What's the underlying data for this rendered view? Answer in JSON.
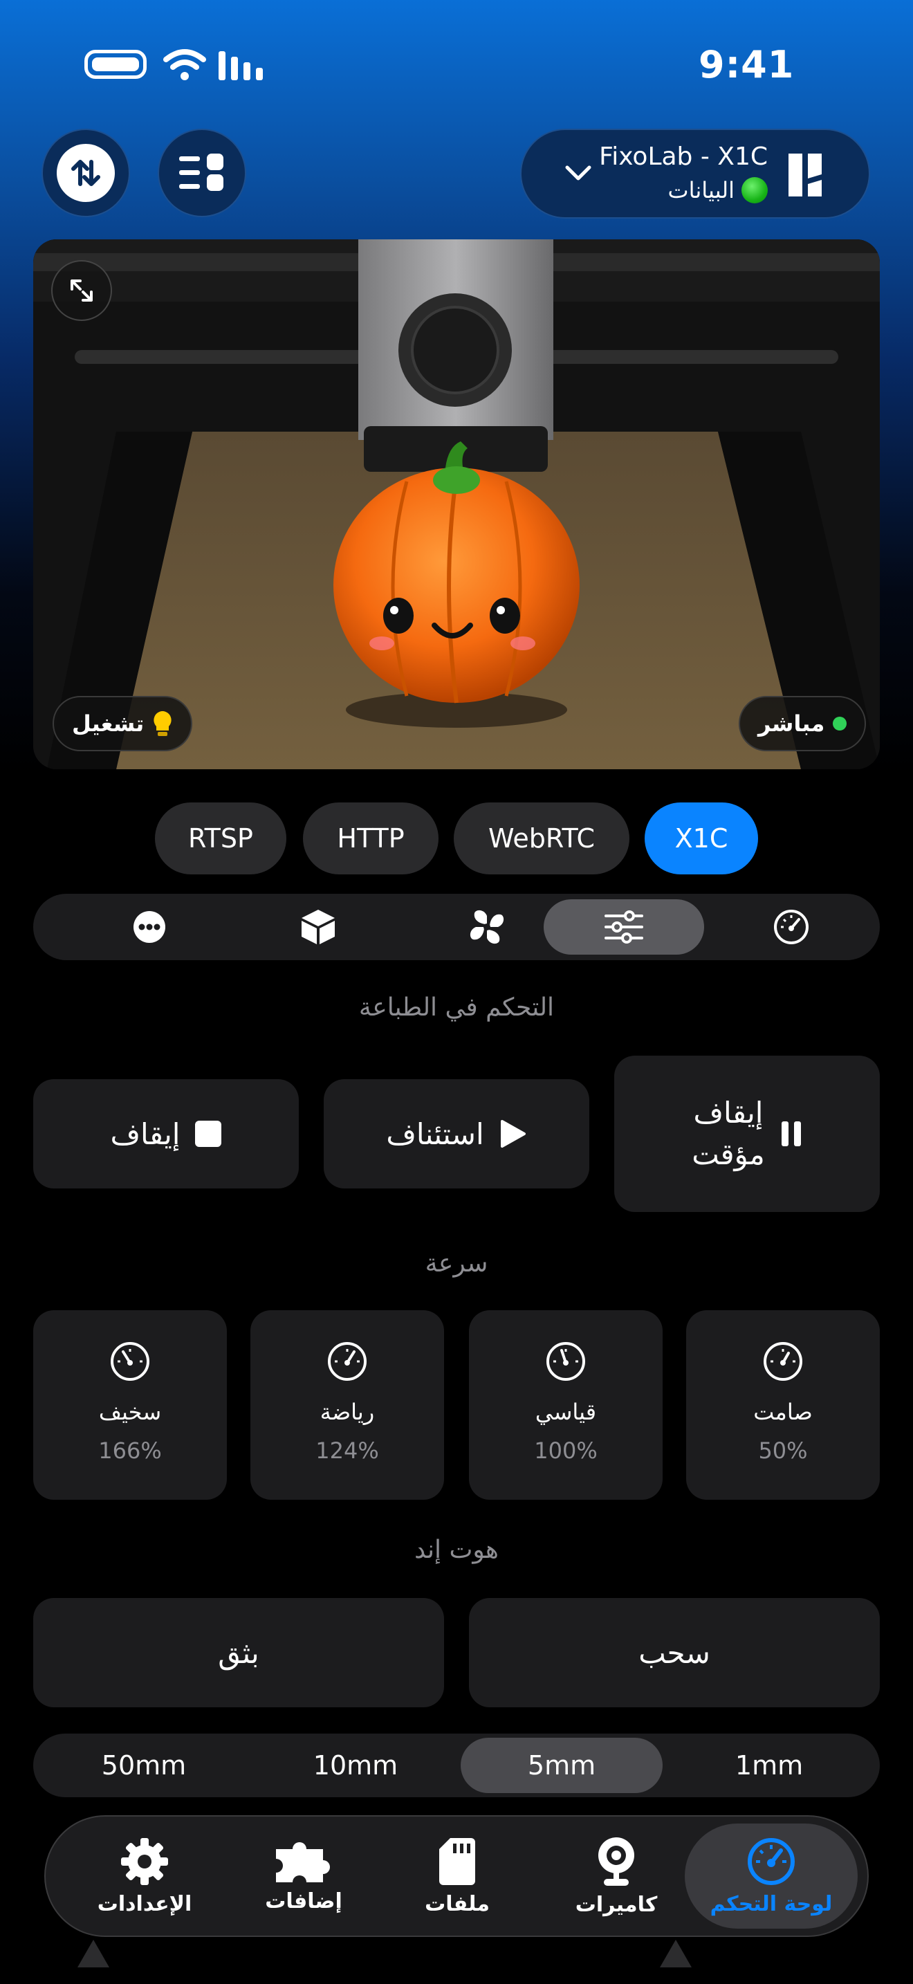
{
  "status_bar": {
    "time": "9:41"
  },
  "header": {
    "printer_name": "FixoLab - X1C",
    "printer_status": "البيانات",
    "status_color": "#1db41d"
  },
  "camera": {
    "live_label": "مباشر",
    "light_label": "تشغيل",
    "live_dot_color": "#30d158"
  },
  "stream_tabs": [
    {
      "label": "RTSP",
      "active": false
    },
    {
      "label": "HTTP",
      "active": false
    },
    {
      "label": "WebRTC",
      "active": false
    },
    {
      "label": "X1C",
      "active": true
    }
  ],
  "segment_icons": [
    "more-icon",
    "box-icon",
    "fan-icon",
    "sliders-icon",
    "gauge-icon"
  ],
  "segment_active": "sliders-icon",
  "printer_control": {
    "title": "التحكم في الطباعة",
    "stop_label": "إيقاف",
    "resume_label": "استئناف",
    "pause_label_line1": "إيقاف",
    "pause_label_line2": "مؤقت"
  },
  "speed": {
    "title": "سرعة",
    "modes": [
      {
        "name": "سخيف",
        "value": "166%"
      },
      {
        "name": "رياضة",
        "value": "124%"
      },
      {
        "name": "قياسي",
        "value": "100%"
      },
      {
        "name": "صامت",
        "value": "50%"
      }
    ]
  },
  "hotend": {
    "title": "هوت إند",
    "extrude_label": "بثق",
    "retract_label": "سحب"
  },
  "distances": [
    {
      "label": "50mm",
      "active": false
    },
    {
      "label": "10mm",
      "active": false
    },
    {
      "label": "5mm",
      "active": true
    },
    {
      "label": "1mm",
      "active": false
    }
  ],
  "tab_bar": [
    {
      "label": "الإعدادات",
      "icon": "gear-icon",
      "active": false
    },
    {
      "label": "إضافات",
      "icon": "puzzle-icon",
      "active": false
    },
    {
      "label": "ملفات",
      "icon": "sd-card-icon",
      "active": false
    },
    {
      "label": "كاميرات",
      "icon": "webcam-icon",
      "active": false
    },
    {
      "label": "لوحة التحكم",
      "icon": "dashboard-icon",
      "active": true
    }
  ],
  "colors": {
    "accent": "#0a84ff",
    "card": "#1c1c1e",
    "muted": "#8e8e93"
  }
}
